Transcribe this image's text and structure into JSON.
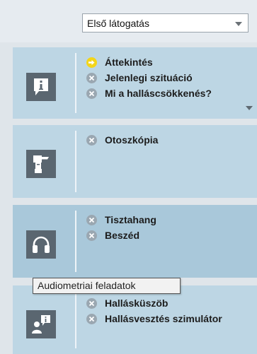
{
  "visit_select": {
    "value": "Első látogatás"
  },
  "panels": [
    {
      "icon": "info-icon",
      "items": [
        {
          "label": "Áttekintés",
          "status": "current"
        },
        {
          "label": "Jelenlegi szituáció",
          "status": "incomplete"
        },
        {
          "label": "Mi a halláscsökkenés?",
          "status": "incomplete"
        }
      ]
    },
    {
      "icon": "otoscope-icon",
      "items": [
        {
          "label": "Otoszkópia",
          "status": "incomplete"
        }
      ]
    },
    {
      "icon": "headphones-icon",
      "items": [
        {
          "label": "Tisztahang",
          "status": "incomplete"
        },
        {
          "label": "Beszéd",
          "status": "incomplete"
        }
      ]
    },
    {
      "icon": "consultation-icon",
      "items": [
        {
          "label": "Hallásküszöb",
          "status": "incomplete"
        },
        {
          "label": "Hallásvesztés szimulátor",
          "status": "incomplete"
        }
      ]
    }
  ],
  "tooltip": "Audiometriai feladatok",
  "colors": {
    "panel": "#bdd6e4",
    "panel_active": "#a9c8da",
    "icon_box": "#5a6670",
    "bullet_incomplete": "#9aa7b1",
    "bullet_current": "#f3d51a"
  }
}
